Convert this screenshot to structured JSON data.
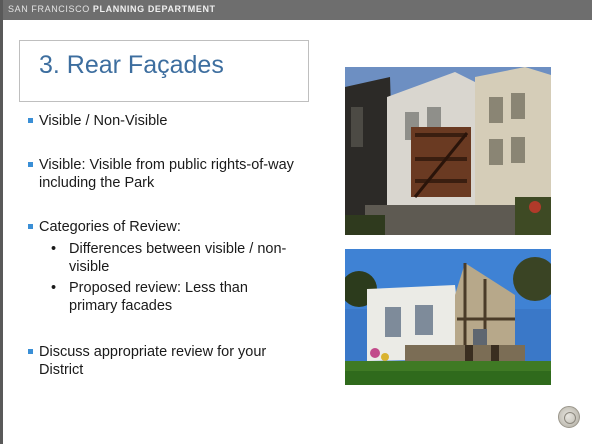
{
  "header": {
    "org_light": "SAN FRANCISCO",
    "org_bold": "PLANNING DEPARTMENT"
  },
  "slide": {
    "title": "3. Rear Façades",
    "bullets": {
      "b1": "Visible / Non-Visible",
      "b2": "Visible: Visible from public rights-of-way including the Park",
      "b3": "Categories of Review:",
      "b3_sub1": "Differences between visible / non-visible",
      "b3_sub2": "Proposed review:  Less than primary facades",
      "b4": "Discuss appropriate review for your District"
    }
  },
  "images": {
    "photo1_icon": "rear-facade-victorian-houses-photo",
    "photo2_icon": "rear-cottage-garden-photo",
    "seal_icon": "city-seal-icon"
  }
}
